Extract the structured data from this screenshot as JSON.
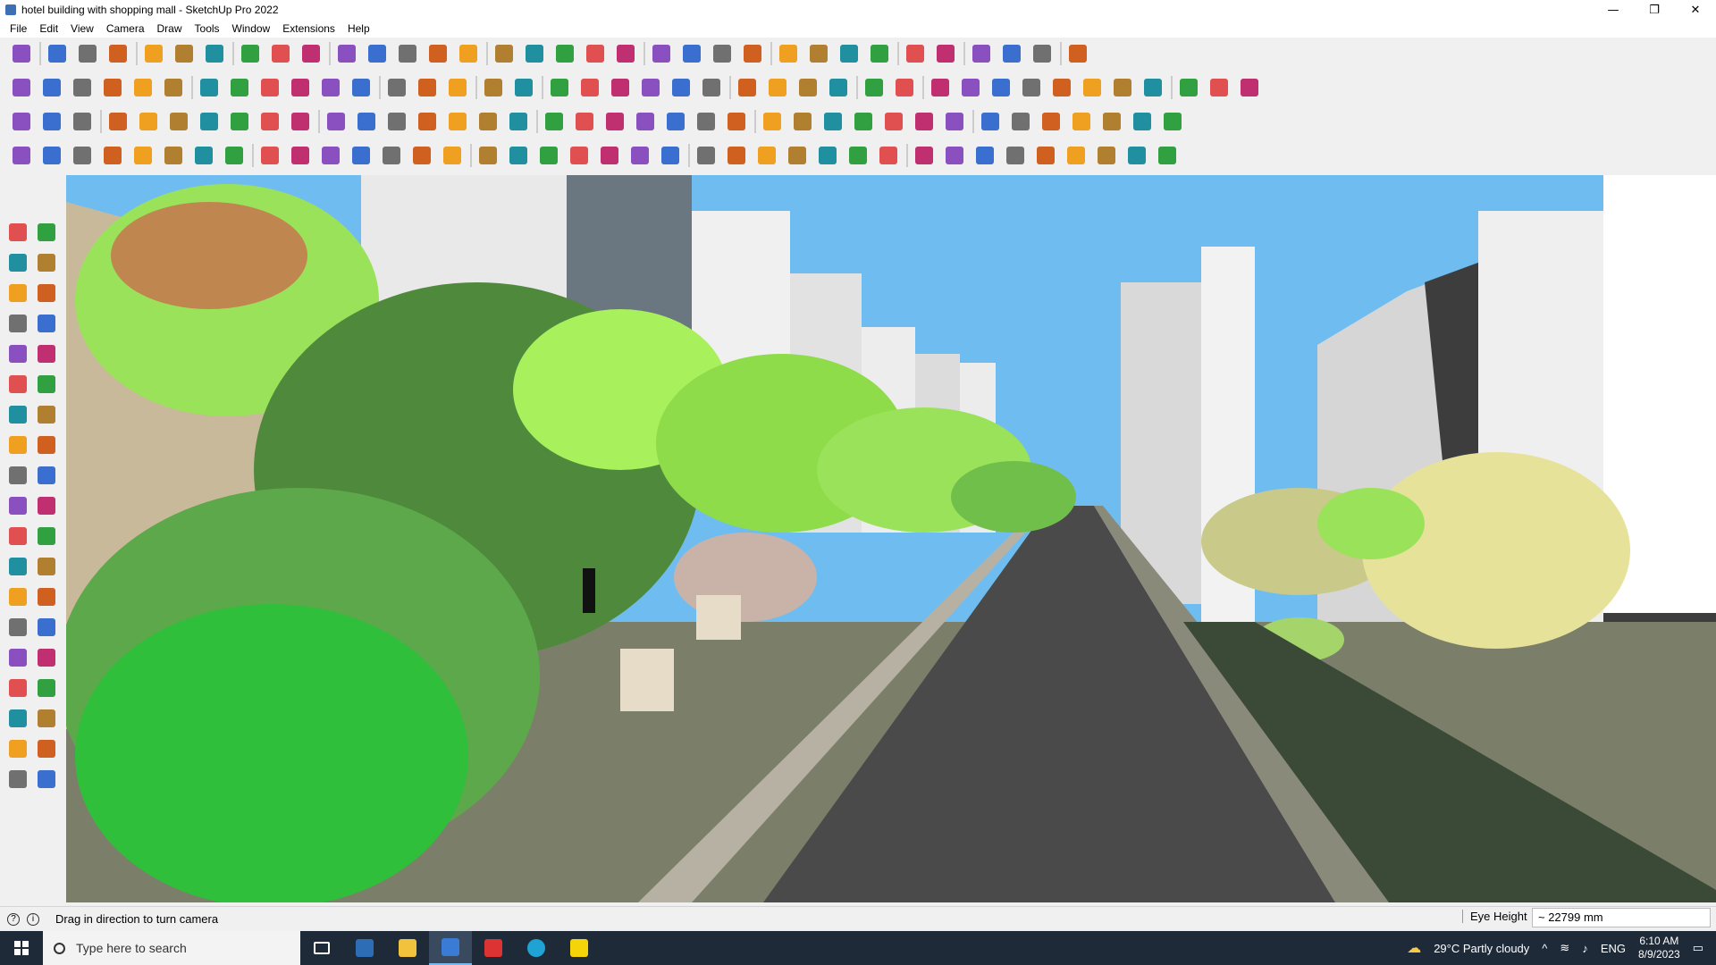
{
  "window": {
    "title": "hotel building with shopping mall - SketchUp Pro 2022",
    "controls": [
      "—",
      "❐",
      "✕"
    ]
  },
  "menu": [
    "File",
    "Edit",
    "View",
    "Camera",
    "Draw",
    "Tools",
    "Window",
    "Extensions",
    "Help"
  ],
  "status": {
    "hint": "Drag in direction to turn camera",
    "vcb_label": "Eye Height",
    "vcb_value": "~ 22799 mm"
  },
  "taskbar": {
    "search_placeholder": "Type here to search",
    "weather": "29°C  Partly cloudy",
    "lang": "ENG",
    "time": "6:10 AM",
    "date": "8/9/2023"
  },
  "colors": {
    "sky": "#6fbdf0",
    "road": "#4a4a4a",
    "tree_dark": "#4f8a3c",
    "tree_light": "#9ae25a",
    "building": "#e8e8e8",
    "taskbar": "#1f2a38"
  }
}
